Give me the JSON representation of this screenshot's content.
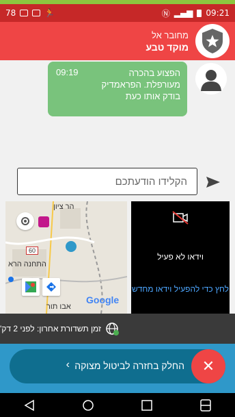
{
  "status_bar": {
    "left_text": "78",
    "time": "09:21"
  },
  "header": {
    "subtitle": "מחובר אל",
    "title": "מוקד טבע"
  },
  "message": {
    "text": "הפצוע בהכרה מעורפלת. הפראמדיק בודק אותו כעת",
    "time": "09:19"
  },
  "composer": {
    "placeholder": "הקלידו הודעתכם"
  },
  "map": {
    "labels": [
      "הר ציון",
      "התחנה הרא",
      "אבו תור"
    ],
    "google": "Google",
    "road_number": "60"
  },
  "video": {
    "status": "וידאו לא פעיל",
    "link": "לחץ כדי להפעיל וידאו מחדש"
  },
  "footer": {
    "last_message": "זמן תשדורת אחרון: לפני 2 דק'"
  },
  "cancel": {
    "label": "החלק בחזרה לביטול מצוקה",
    "arrow": "‹",
    "x": "✕"
  },
  "colors": {
    "status_bar": "#c62828",
    "header": "#ef4545",
    "bubble": "#79c37c",
    "cancel_area": "#2f98c9",
    "cancel_pill": "#0f6e8f",
    "link": "#4da6ff"
  }
}
